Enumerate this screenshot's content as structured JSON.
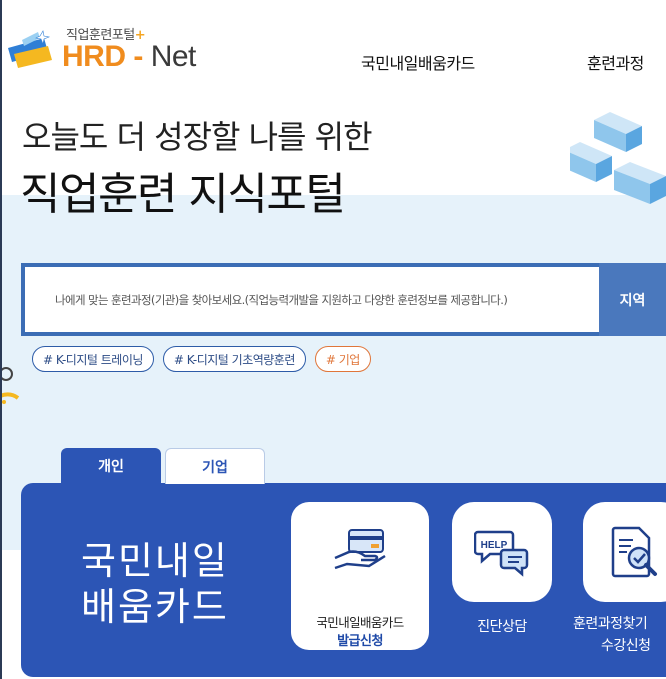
{
  "logo": {
    "subtitle": "직업훈련포털",
    "plus": "+",
    "brand_hrd": "HRD",
    "brand_dash": "-",
    "brand_net": "Net"
  },
  "nav": {
    "items": [
      "국민내일배움카드",
      "훈련과정"
    ]
  },
  "hero": {
    "line1": "오늘도 더 성장할 나를 위한",
    "line2": "직업훈련 지식포털"
  },
  "search": {
    "placeholder": "나에게 맞는 훈련과정(기관)을 찾아보세요.(직업능력개발을 지원하고 다양한 훈련정보를 제공합니다.)",
    "button_label": "지역"
  },
  "tags": [
    {
      "label": "# K-디지털 트레이닝",
      "style": "blue"
    },
    {
      "label": "# K-디지털 기초역량훈련",
      "style": "blue"
    },
    {
      "label": "# 기업",
      "style": "orange"
    }
  ],
  "tabs": [
    {
      "label": "개인",
      "active": true
    },
    {
      "label": "기업",
      "active": false
    }
  ],
  "panel": {
    "title_line1": "국민내일",
    "title_line2": "배움카드",
    "card1_line1": "국민내일배움카드",
    "card1_line2": "발급신청",
    "card2_label": "진단상담",
    "card2_icon_text": "HELP",
    "card3_line1": "훈련과정찾기",
    "card3_line2": "수강신청"
  },
  "colors": {
    "primary_blue": "#2c55b5",
    "search_blue": "#4a78bd",
    "brand_orange": "#f08c1e",
    "tag_orange": "#e0763a",
    "hero_bg": "#e6f2fa"
  },
  "icons": [
    "card-in-hand-icon",
    "help-chat-icon",
    "document-search-icon"
  ]
}
